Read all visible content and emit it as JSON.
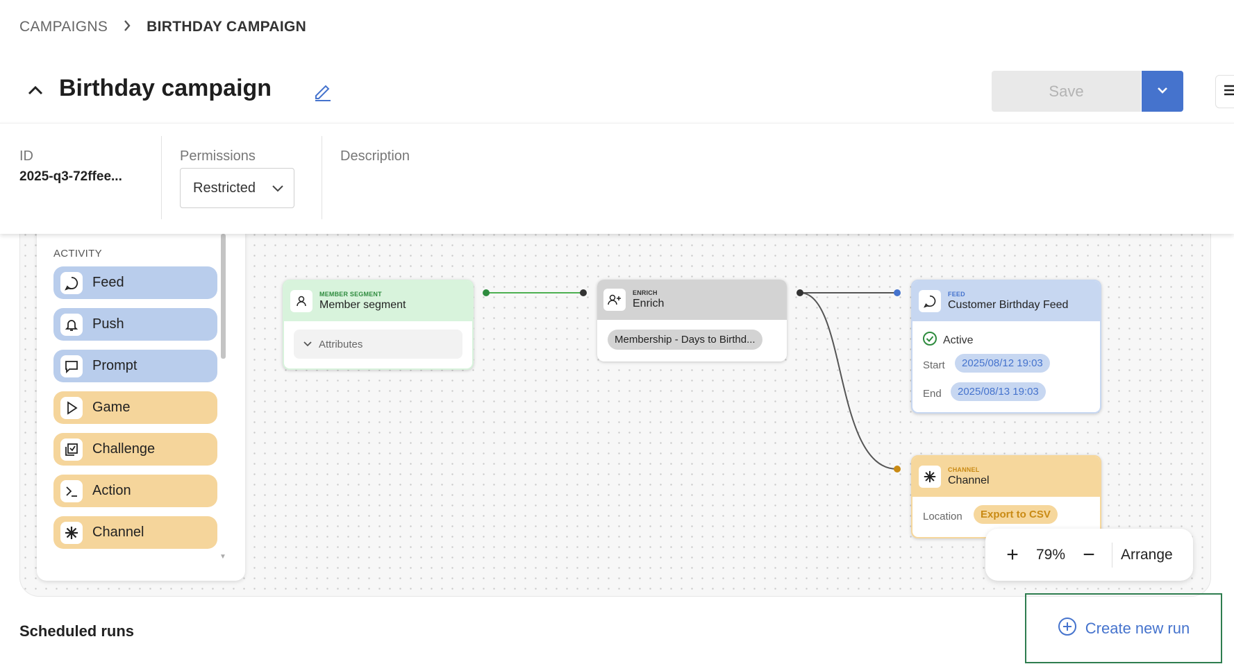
{
  "breadcrumb": {
    "items": [
      "CAMPAIGNS",
      "BIRTHDAY CAMPAIGN"
    ]
  },
  "header": {
    "title": "Birthday campaign",
    "save_label": "Save"
  },
  "info": {
    "id_label": "ID",
    "id_value": "2025-q3-72ffee...",
    "permissions_label": "Permissions",
    "permissions_value": "Restricted",
    "description_label": "Description"
  },
  "palette": {
    "heading": "ACTIVITY",
    "items": [
      {
        "label": "Feed",
        "icon": "chat-bubble-icon",
        "color": "#b9cdec"
      },
      {
        "label": "Push",
        "icon": "bell-icon",
        "color": "#b9cdec"
      },
      {
        "label": "Prompt",
        "icon": "message-square-icon",
        "color": "#b9cdec"
      },
      {
        "label": "Game",
        "icon": "play-icon",
        "color": "#f5d59b"
      },
      {
        "label": "Challenge",
        "icon": "checklist-icon",
        "color": "#f5d59b"
      },
      {
        "label": "Action",
        "icon": "terminal-icon",
        "color": "#f5d59b"
      },
      {
        "label": "Channel",
        "icon": "asterisk-icon",
        "color": "#f5d59b"
      }
    ]
  },
  "nodes": {
    "segment": {
      "kind": "MEMBER SEGMENT",
      "name": "Member segment",
      "attributes_label": "Attributes",
      "color": "#d8f3dc",
      "accent": "#2e8b3e"
    },
    "enrich": {
      "kind": "ENRICH",
      "name": "Enrich",
      "chip": "Membership - Days to Birthd...",
      "color": "#d3d3d3"
    },
    "feed": {
      "kind": "FEED",
      "name": "Customer Birthday Feed",
      "status": "Active",
      "start_label": "Start",
      "start_value": "2025/08/12 19:03",
      "end_label": "End",
      "end_value": "2025/08/13 19:03",
      "color": "#c7d7f1",
      "accent": "#4573cd"
    },
    "channel": {
      "kind": "CHANNEL",
      "name": "Channel",
      "location_label": "Location",
      "location_value": "Export to CSV",
      "color": "#f6d79c",
      "accent": "#c98a14"
    }
  },
  "zoom": {
    "plus": "+",
    "value": "79%",
    "minus": "−",
    "arrange_label": "Arrange"
  },
  "scheduled": {
    "title": "Scheduled runs",
    "create_label": "Create new run"
  }
}
